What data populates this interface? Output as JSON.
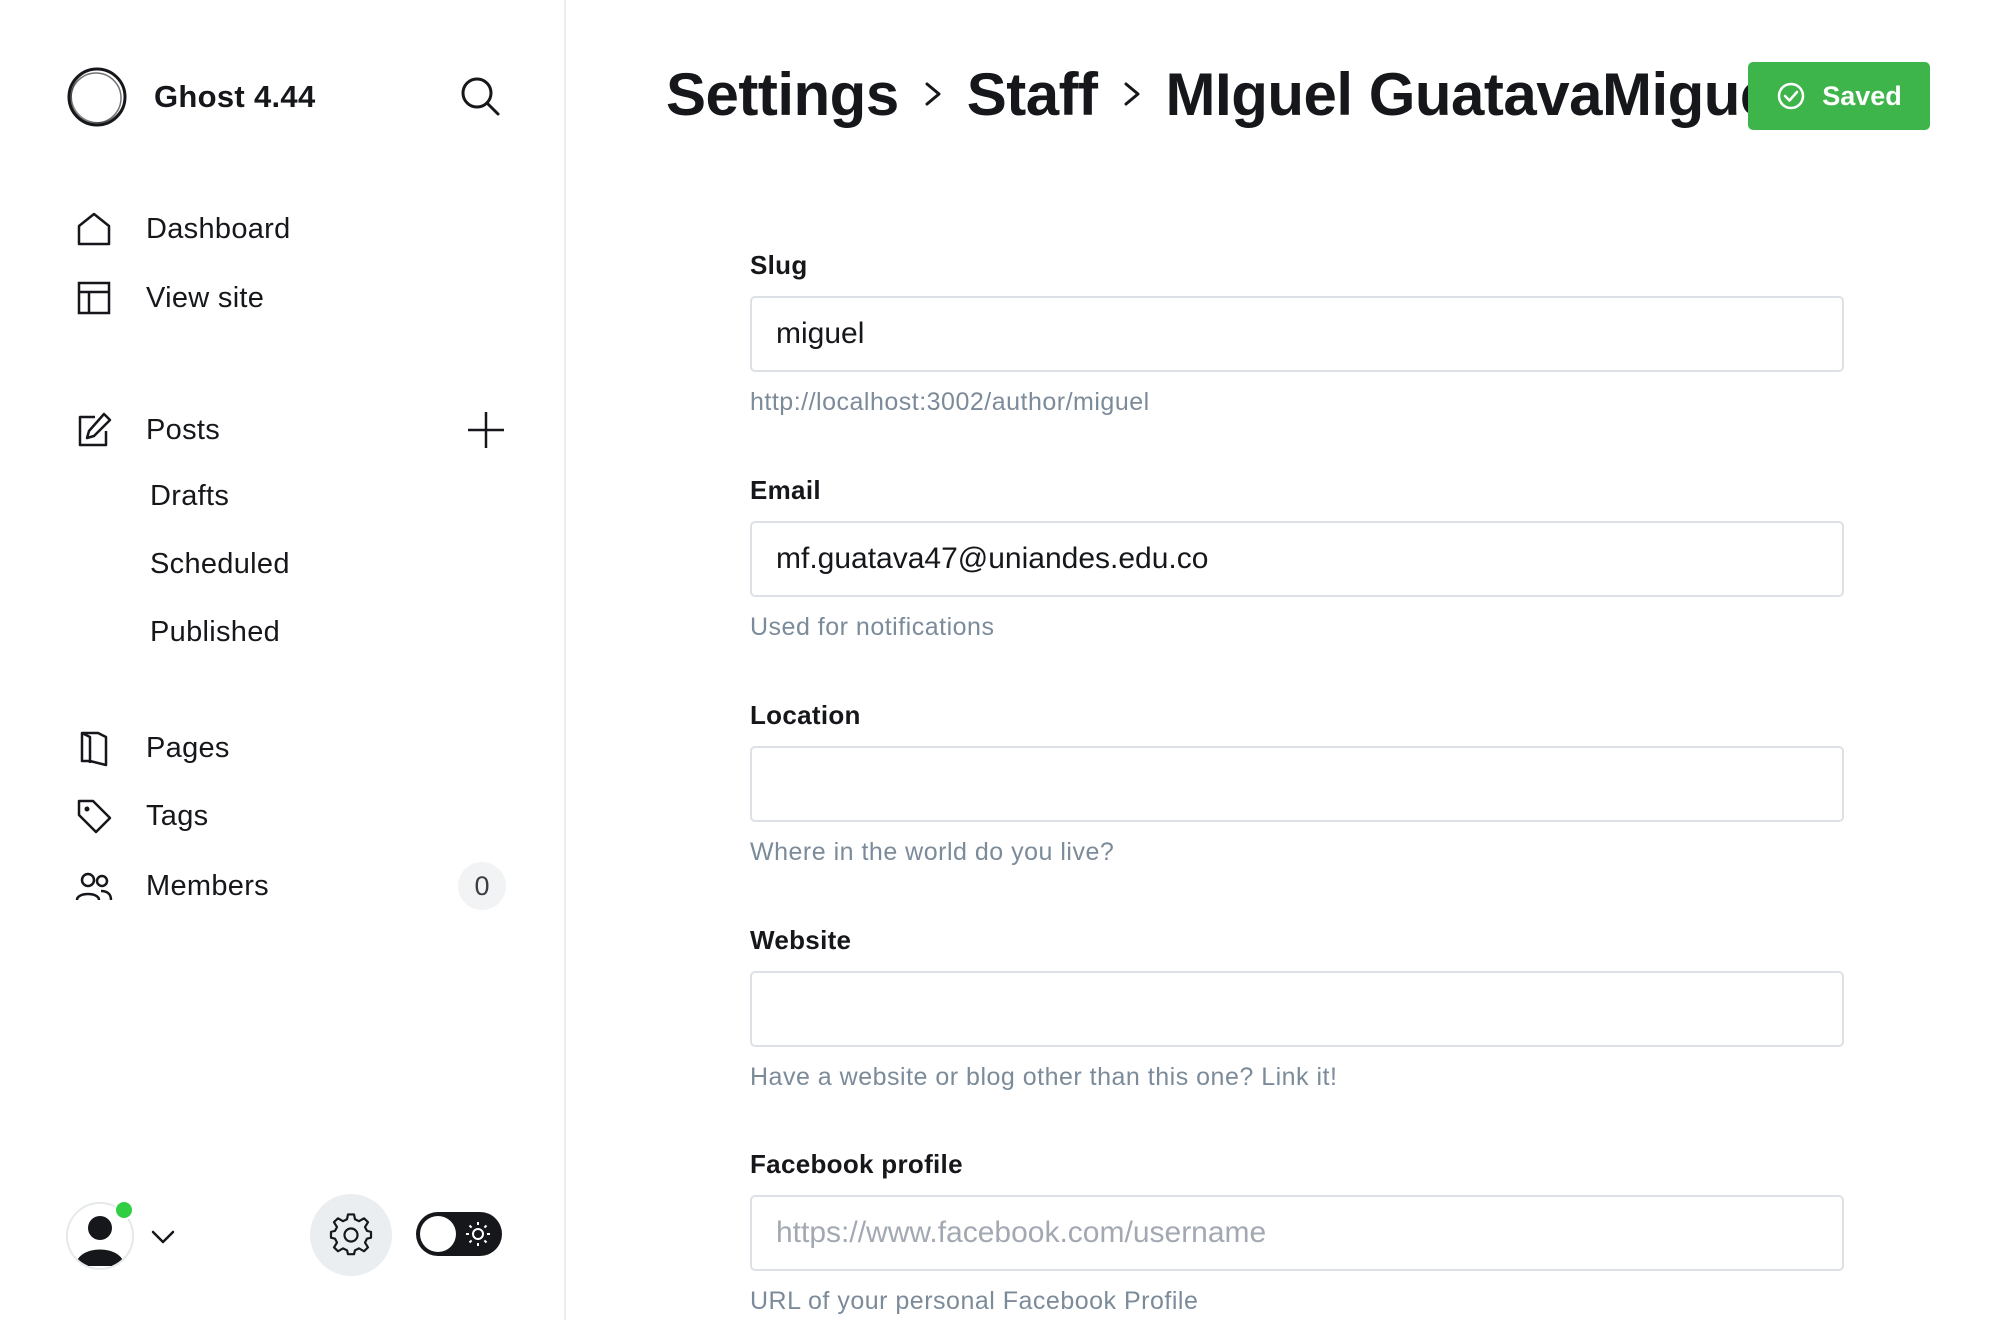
{
  "brand": {
    "name": "Ghost 4.44"
  },
  "sidebar": {
    "items": [
      {
        "label": "Dashboard",
        "icon": "home-icon"
      },
      {
        "label": "View site",
        "icon": "layout-icon"
      },
      {
        "label": "Posts",
        "icon": "edit-icon"
      },
      {
        "label": "Pages",
        "icon": "pages-icon"
      },
      {
        "label": "Tags",
        "icon": "tag-icon"
      },
      {
        "label": "Members",
        "icon": "members-icon"
      }
    ],
    "post_subitems": [
      "Drafts",
      "Scheduled",
      "Published"
    ],
    "members_count": "0"
  },
  "header": {
    "breadcrumb": [
      "Settings",
      "Staff",
      "MIguel GuatavaMiguel"
    ],
    "saved_label": "Saved"
  },
  "form": {
    "slug": {
      "label": "Slug",
      "value": "miguel",
      "hint": "http://localhost:3002/author/miguel"
    },
    "email": {
      "label": "Email",
      "value": "mf.guatava47@uniandes.edu.co",
      "hint": "Used for notifications"
    },
    "location": {
      "label": "Location",
      "value": "",
      "hint": "Where in the world do you live?"
    },
    "website": {
      "label": "Website",
      "value": "",
      "hint": "Have a website or blog other than this one? Link it!"
    },
    "facebook": {
      "label": "Facebook profile",
      "value": "",
      "placeholder": "https://www.facebook.com/username",
      "hint": "URL of your personal Facebook Profile"
    }
  },
  "colors": {
    "accent_green": "#3eb54a",
    "status_online": "#30cf43",
    "text_primary": "#15171a",
    "hint_text": "#7c8b9a"
  }
}
